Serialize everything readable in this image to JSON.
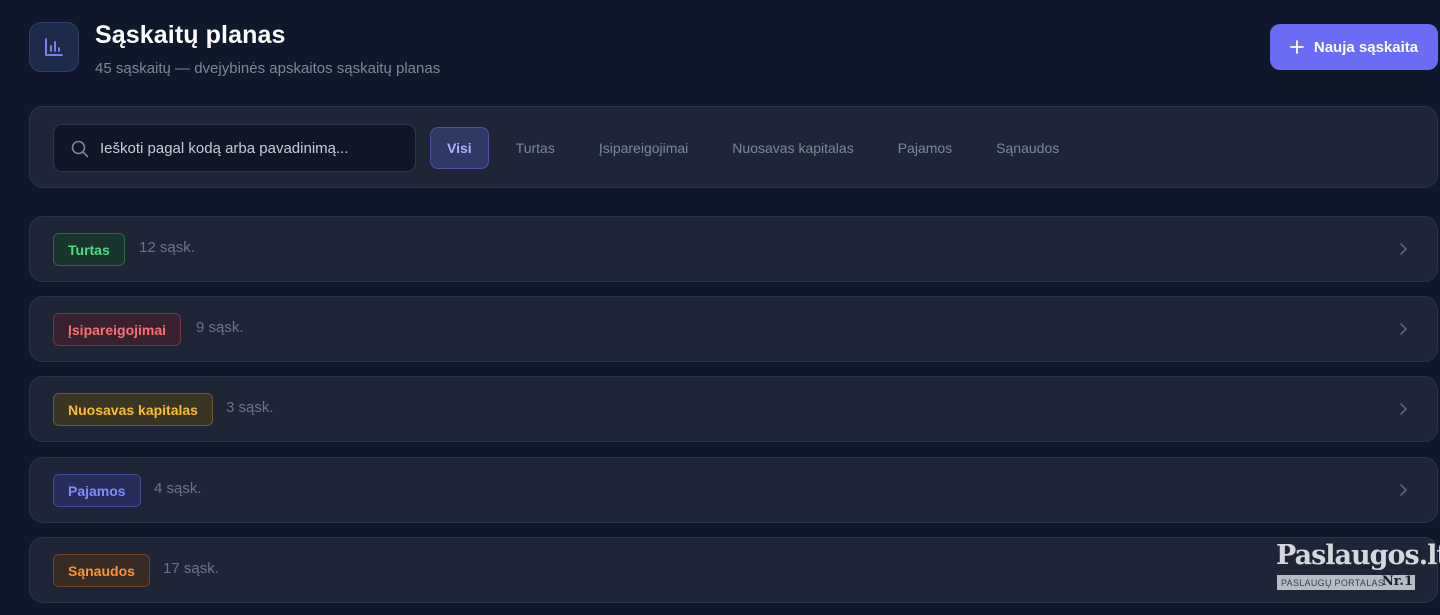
{
  "header": {
    "title": "Sąskaitų planas",
    "subtitle": "45 sąskaitų — dvejybinės apskaitos sąskaitų planas",
    "icon": "bar-chart-icon",
    "new_button_label": "Nauja sąskaita",
    "new_button_icon": "plus-icon"
  },
  "search": {
    "placeholder": "Ieškoti pagal kodą arba pavadinimą...",
    "value": ""
  },
  "filter_tabs": [
    {
      "label": "Visi",
      "active": true
    },
    {
      "label": "Turtas",
      "active": false
    },
    {
      "label": "Įsipareigojimai",
      "active": false
    },
    {
      "label": "Nuosavas kapitalas",
      "active": false
    },
    {
      "label": "Pajamos",
      "active": false
    },
    {
      "label": "Sąnaudos",
      "active": false
    }
  ],
  "groups": [
    {
      "label": "Turtas",
      "count": "12 sąsk.",
      "color": "#4ade80"
    },
    {
      "label": "Įsipareigojimai",
      "count": "9 sąsk.",
      "color": "#f87171"
    },
    {
      "label": "Nuosavas kapitalas",
      "count": "3 sąsk.",
      "color": "#fbbf24"
    },
    {
      "label": "Pajamos",
      "count": "4 sąsk.",
      "color": "#818cf8"
    },
    {
      "label": "Sąnaudos",
      "count": "17 sąsk.",
      "color": "#fb923c"
    }
  ],
  "colors": {
    "background": "#0f172a",
    "panel": "#1e2536",
    "accent": "#6a6cf6"
  },
  "watermark": {
    "title": "Paslaugos.lt",
    "subtitle": "PASLAUGŲ PORTALAS",
    "rank": "Nr.1"
  }
}
